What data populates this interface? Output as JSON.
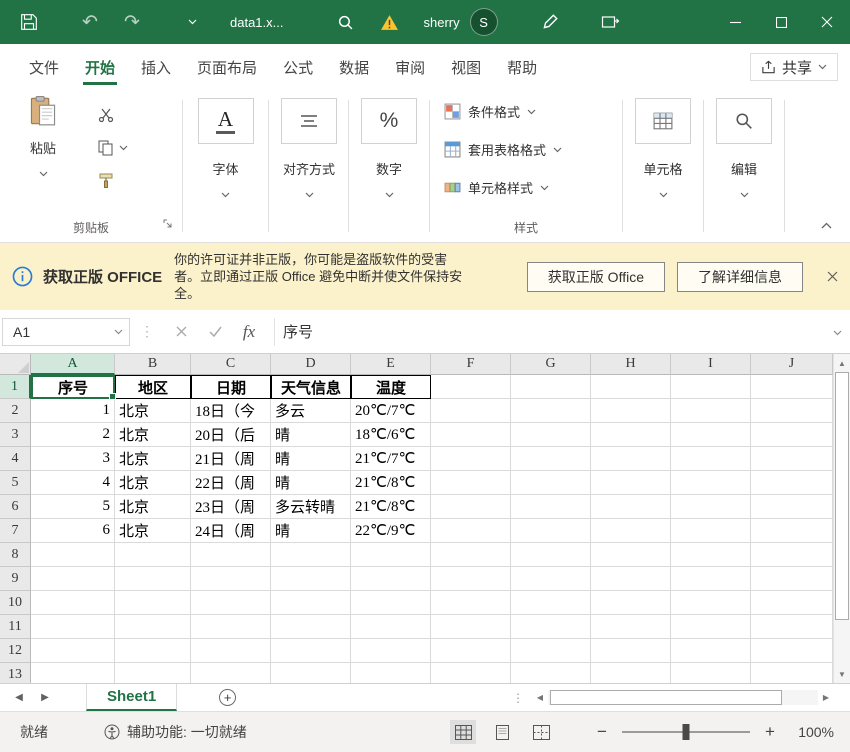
{
  "app": {
    "accent_color": "#217346",
    "notification_bg": "#FBF2CC",
    "warning_color": "#FCC42C"
  },
  "titlebar": {
    "filename": "data1.x...",
    "user_name": "sherry",
    "avatar_initial": "S"
  },
  "ribbon_tabs": {
    "items": [
      "文件",
      "开始",
      "插入",
      "页面布局",
      "公式",
      "数据",
      "审阅",
      "视图",
      "帮助"
    ],
    "share_label": "共享"
  },
  "ribbon": {
    "paste_label": "粘贴",
    "clipboard_group_label": "剪贴板",
    "font_label": "字体",
    "font_icon_glyph": "A",
    "alignment_label": "对齐方式",
    "number_label": "数字",
    "number_icon_glyph": "%",
    "conditional_format_label": "条件格式",
    "format_as_table_label": "套用表格格式",
    "cell_styles_label": "单元格样式",
    "styles_group_label": "样式",
    "cells_label": "单元格",
    "editing_label": "编辑"
  },
  "notification": {
    "title": "获取正版 OFFICE",
    "message": "你的许可证并非正版，你可能是盗版软件的受害者。立即通过正版 Office 避免中断并使文件保持安全。",
    "primary_button": "获取正版 Office",
    "secondary_button": "了解详细信息"
  },
  "formula_bar": {
    "name_box": "A1",
    "fx_label": "fx",
    "content": "序号"
  },
  "grid": {
    "columns": [
      "A",
      "B",
      "C",
      "D",
      "E",
      "F",
      "G",
      "H",
      "I",
      "J"
    ],
    "visible_rows": 13,
    "selected_cell": "A1",
    "selected_column": "A",
    "selected_row": 1,
    "table": {
      "headers": [
        "序号",
        "地区",
        "日期",
        "天气信息",
        "温度"
      ],
      "rows": [
        [
          "1",
          "北京",
          "18日（今",
          "多云",
          "20℃/7℃"
        ],
        [
          "2",
          "北京",
          "20日（后",
          "晴",
          "18℃/6℃"
        ],
        [
          "3",
          "北京",
          "21日（周",
          "晴",
          "21℃/7℃"
        ],
        [
          "4",
          "北京",
          "22日（周",
          "晴",
          "21℃/8℃"
        ],
        [
          "5",
          "北京",
          "23日（周",
          "多云转晴",
          "21℃/8℃"
        ],
        [
          "6",
          "北京",
          "24日（周",
          "晴",
          "22℃/9℃"
        ]
      ]
    }
  },
  "sheet_bar": {
    "tabs": [
      "Sheet1"
    ]
  },
  "status_bar": {
    "ready": "就绪",
    "accessibility": "辅助功能: 一切就绪",
    "zoom": "100%",
    "zoom_out_glyph": "−",
    "zoom_in_glyph": "+"
  }
}
